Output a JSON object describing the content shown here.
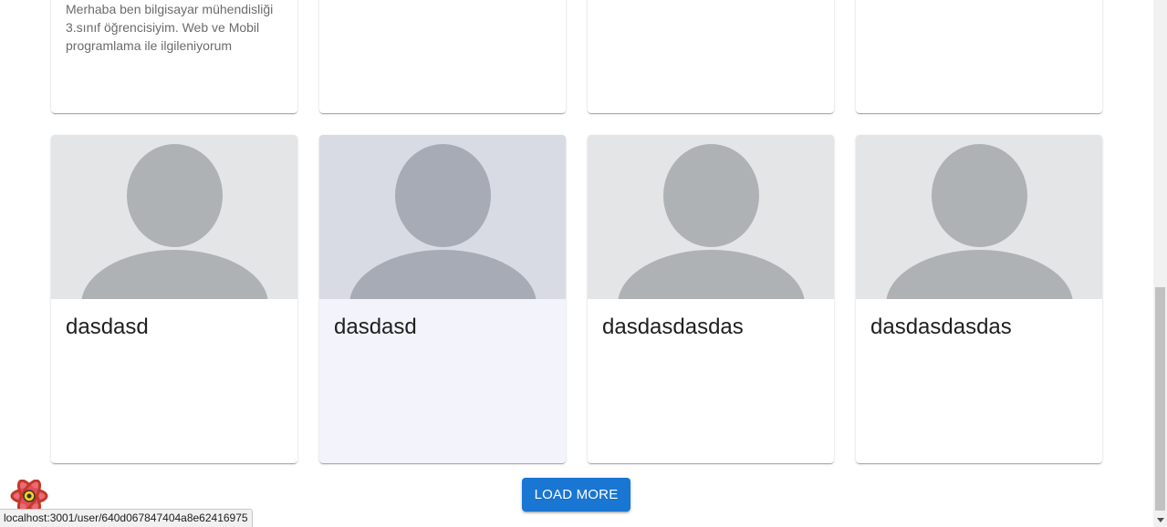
{
  "row1": {
    "cards": [
      {
        "bio": "Merhaba ben bilgisayar mühendisliği 3.sınıf öğrencisiyim. Web ve Mobil programlama ile ilgileniyorum"
      },
      {
        "bio": ""
      },
      {
        "bio": ""
      },
      {
        "bio": ""
      }
    ]
  },
  "row2": {
    "cards": [
      {
        "title": "dasdasd"
      },
      {
        "title": "dasdasd"
      },
      {
        "title": "dasdasdasdas"
      },
      {
        "title": "dasdasdasdas"
      }
    ]
  },
  "load_more": {
    "label": "LOAD MORE"
  },
  "status_bar": {
    "url": "localhost:3001/user/640d067847404a8e62416975"
  },
  "icons": {
    "avatar_placeholder": "person-silhouette-icon",
    "devtools": "react-devtools-icon"
  },
  "colors": {
    "primary": "#1976d2",
    "hover_card": "#f3f4fb",
    "avatar_bg": "#e4e5e7",
    "avatar_fg": "#aeb2b5"
  }
}
